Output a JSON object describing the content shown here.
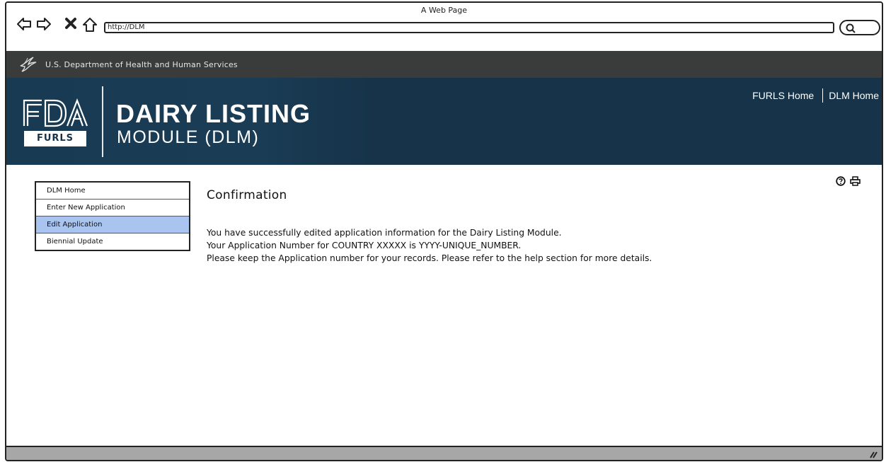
{
  "window": {
    "title": "A Web Page"
  },
  "browser": {
    "url": "http://DLM",
    "icons": [
      "back-arrow-icon",
      "forward-arrow-icon",
      "close-x-icon",
      "home-icon",
      "search-icon"
    ]
  },
  "hhs": {
    "label": "U.S. Department of Health and Human Services"
  },
  "banner": {
    "badge": "FURLS",
    "title_line1": "DAIRY LISTING",
    "title_line2": "MODULE (DLM)",
    "links": [
      "FURLS Home",
      "DLM Home"
    ],
    "bg_color": "#163349"
  },
  "sidebar": {
    "items": [
      {
        "label": "DLM Home",
        "active": false
      },
      {
        "label": "Enter New Application",
        "active": false
      },
      {
        "label": "Edit Application",
        "active": true
      },
      {
        "label": "Biennial Update",
        "active": false
      }
    ],
    "active_color": "#a8c4ef"
  },
  "utility": {
    "icons": [
      "help-icon",
      "print-icon"
    ]
  },
  "main": {
    "title": "Confirmation",
    "lines": [
      "You have successfully edited application information for the Dairy Listing Module.",
      "Your Application Number for COUNTRY XXXXX is YYYY-UNIQUE_NUMBER.",
      "Please keep the Application number for your records. Please refer to the help section for more details."
    ]
  }
}
